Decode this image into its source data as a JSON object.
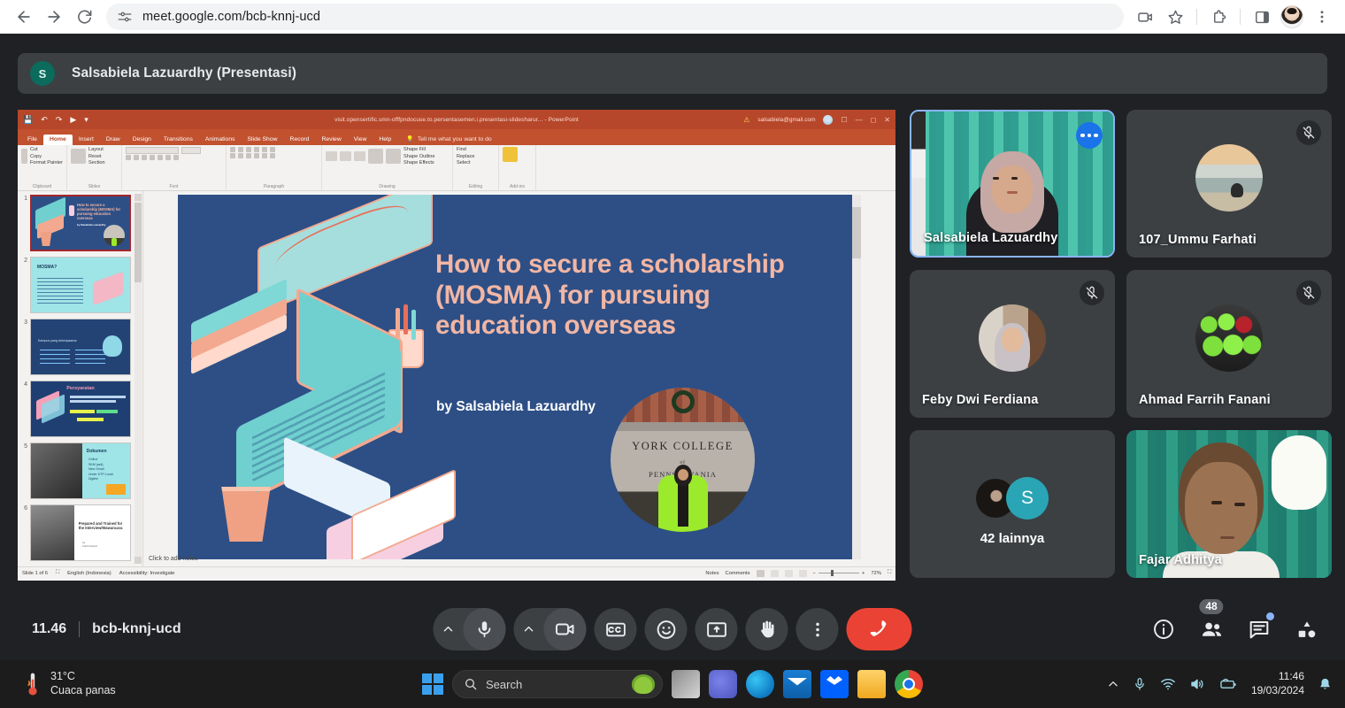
{
  "browser": {
    "back_label": "Back",
    "forward_label": "Forward",
    "reload_label": "Reload",
    "site_info_label": "View site information",
    "url": "meet.google.com/bcb-knnj-ucd",
    "video_icon": "video-call-icon",
    "bookmark_icon": "star-icon",
    "extensions_icon": "puzzle-icon",
    "sidepanel_icon": "side-panel-icon",
    "profile_icon": "profile-avatar",
    "menu_icon": "three-dot-menu-icon"
  },
  "meet": {
    "presenter": {
      "initial": "S",
      "name": "Salsabiela Lazuardhy (Presentasi)"
    },
    "bottom": {
      "time": "11.46",
      "meeting_code": "bcb-knnj-ucd",
      "mic_label": "Microphone",
      "camera_label": "Camera",
      "captions_label": "Captions",
      "reactions_label": "Reactions",
      "present_label": "Present now",
      "raise_hand_label": "Raise hand",
      "more_label": "More options",
      "end_call_label": "Leave call",
      "info_label": "Meeting details",
      "people_label": "People",
      "people_count": "48",
      "chat_label": "Chat",
      "activities_label": "Activities"
    },
    "tiles": [
      {
        "name": "Salsabiela Lazuardhy",
        "muted": false,
        "active": true,
        "kind": "video-self"
      },
      {
        "name": "107_Ummu Farhati",
        "muted": true,
        "active": false,
        "kind": "avatar-beach"
      },
      {
        "name": "Feby Dwi Ferdiana",
        "muted": true,
        "active": false,
        "kind": "avatar-feby"
      },
      {
        "name": "Ahmad Farrih Fanani",
        "muted": true,
        "active": false,
        "kind": "avatar-crowd"
      },
      {
        "name": "42 lainnya",
        "muted": false,
        "active": false,
        "kind": "more-stack",
        "stack_initial": "S"
      },
      {
        "name": "Fajar Adhitya",
        "muted": false,
        "active": false,
        "kind": "video-fajar"
      }
    ]
  },
  "powerpoint": {
    "doc_title": "visit.opensertific.smn-offfpndocuse.to.persentasemen.i.presentasi-slidesharur... - PowerPoint",
    "account_email": "salsabiela@gmail.com",
    "quick_access": [
      "save-icon",
      "undo-icon",
      "redo-icon",
      "present-icon",
      "customize-icon"
    ],
    "window_controls": [
      "minimize",
      "restore",
      "close"
    ],
    "tabs": [
      "File",
      "Home",
      "Insert",
      "Draw",
      "Design",
      "Transitions",
      "Animations",
      "Slide Show",
      "Record",
      "Review",
      "View",
      "Help"
    ],
    "active_tab": "Home",
    "tell_me": "Tell me what you want to do",
    "ribbon_groups": [
      {
        "name": "Clipboard",
        "items": [
          "Paste",
          "Cut",
          "Copy",
          "Format Painter"
        ]
      },
      {
        "name": "Slides",
        "items": [
          "New Slide",
          "Layout",
          "Reset",
          "Section"
        ]
      },
      {
        "name": "Font",
        "items": [
          "Font",
          "Size",
          "Bold",
          "Italic",
          "Underline"
        ]
      },
      {
        "name": "Paragraph",
        "items": [
          "Bullets",
          "Numbering",
          "Align",
          "Columns"
        ]
      },
      {
        "name": "Drawing",
        "items": [
          "Shapes",
          "Arrange",
          "Quick Styles",
          "Shape Fill",
          "Shape Outline",
          "Shape Effects"
        ]
      },
      {
        "name": "Editing",
        "items": [
          "Find",
          "Replace",
          "Select"
        ]
      },
      {
        "name": "Add-ins",
        "items": [
          "Add-ins"
        ]
      }
    ],
    "slides": [
      {
        "n": "1",
        "title": "How to secure a scholarship (MOSMA) for pursuing education overseas",
        "selected": true
      },
      {
        "n": "2",
        "title": "MOSMA?",
        "selected": false
      },
      {
        "n": "3",
        "title": "Kampus yang bekerjasama",
        "selected": false
      },
      {
        "n": "4",
        "title": "Persyaratan",
        "selected": false
      },
      {
        "n": "5",
        "title": "Dokumen",
        "selected": false
      },
      {
        "n": "6",
        "title": "Prepared and Trained for the Interview/Wawancara",
        "selected": false
      }
    ],
    "slide": {
      "title": "How to secure a scholarship (MOSMA) for pursuing education overseas",
      "byline": "by Salsabiela Lazuardhy",
      "photo_line1": "YORK COLLEGE",
      "photo_line2": "of",
      "photo_line3": "PENNSYLVANIA",
      "notes_placeholder": "Click to add notes"
    },
    "statusbar": {
      "slide_position": "Slide 1 of 6",
      "language": "English (Indonesia)",
      "accessibility": "Accessibility: Investigate",
      "notes_label": "Notes",
      "comments_label": "Comments",
      "zoom_level": "72%"
    }
  },
  "taskbar": {
    "weather_temp": "31°C",
    "weather_desc": "Cuaca panas",
    "start_label": "Start",
    "search_placeholder": "Search",
    "apps": [
      "task-view-icon",
      "teams-icon",
      "edge-icon",
      "mail-icon",
      "dropbox-icon",
      "file-explorer-icon",
      "chrome-icon"
    ],
    "tray": [
      "show-hidden-icons",
      "microphone-icon",
      "wifi-icon",
      "volume-icon",
      "battery-icon"
    ],
    "clock_time": "11:46",
    "clock_date": "19/03/2024",
    "notification_label": "Notifications"
  }
}
